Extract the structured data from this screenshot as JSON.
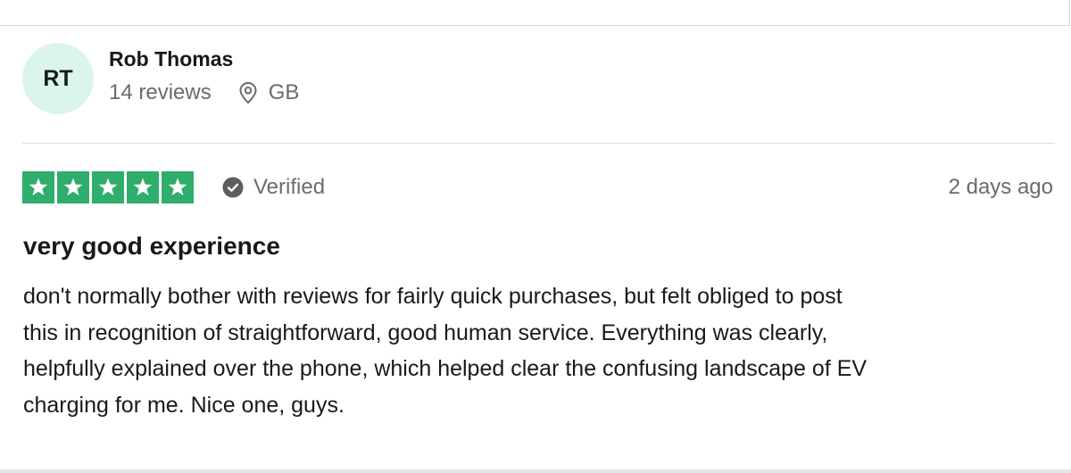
{
  "consumer": {
    "initials": "RT",
    "name": "Rob Thomas",
    "reviews_count": "14 reviews",
    "country": "GB"
  },
  "review": {
    "stars": 5,
    "star_color": "#2ead6b",
    "verified_label": "Verified",
    "date": "2 days ago",
    "title": "very good experience",
    "text_lines": [
      "don't normally bother with reviews for fairly quick purchases, but felt obliged to post",
      "this in recognition of straightforward, good human service. Everything was clearly,",
      "helpfully explained over the phone, which helped clear the confusing landscape of EV",
      "charging for me. Nice one, guys."
    ]
  },
  "icons": {
    "location": "location-pin-icon",
    "verified": "verified-check-icon",
    "star": "star-icon"
  }
}
